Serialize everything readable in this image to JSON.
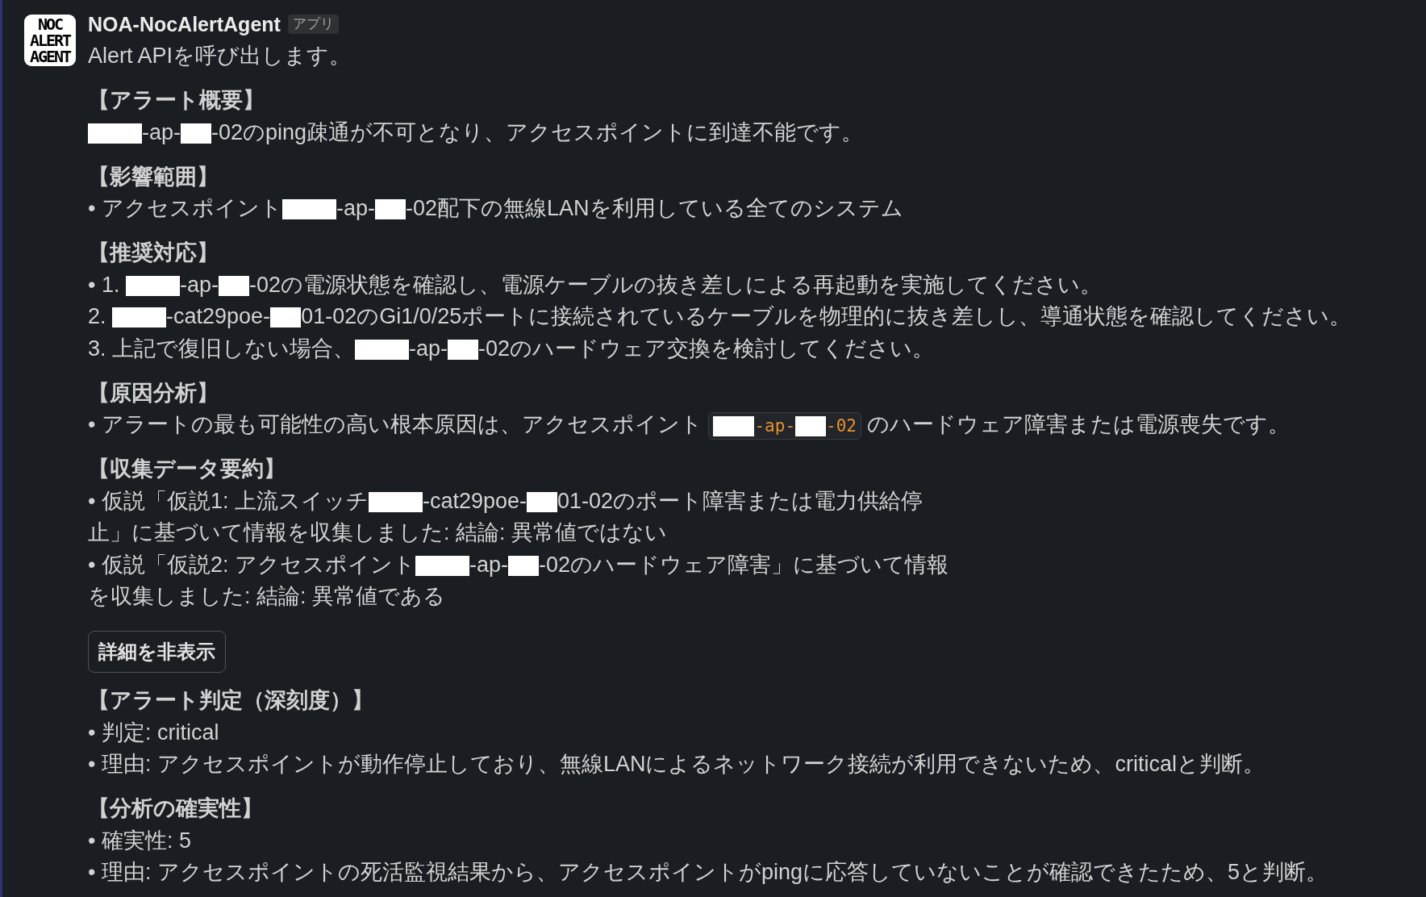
{
  "message": {
    "avatar": {
      "logo_lines": [
        "NOC",
        "ALERT",
        "AGENT"
      ]
    },
    "sender": "NOA-NocAlertAgent",
    "badge": "アプリ",
    "intro": "Alert APIを呼び出します。",
    "sections": [
      {
        "kind": "full",
        "heading": "【アラート概要】",
        "paragraphs": [
          [
            {
              "kind": "redaction_long"
            },
            {
              "kind": "text",
              "text": "-ap-"
            },
            {
              "kind": "redaction_short"
            },
            {
              "kind": "text",
              "text": "-02のping疎通が不可となり、アクセスポイントに到達不能です。"
            }
          ]
        ]
      },
      {
        "kind": "full",
        "heading": "【影響範囲】",
        "paragraphs": [
          [
            {
              "kind": "text",
              "text": "• アクセスポイント"
            },
            {
              "kind": "redaction_long"
            },
            {
              "kind": "text",
              "text": "-ap-"
            },
            {
              "kind": "redaction_short"
            },
            {
              "kind": "text",
              "text": "-02配下の無線LANを利用している全てのシステム"
            }
          ]
        ]
      },
      {
        "kind": "full",
        "heading": "【推奨対応】",
        "paragraphs": [
          [
            {
              "kind": "text",
              "text": "• 1. "
            },
            {
              "kind": "redaction_long"
            },
            {
              "kind": "text",
              "text": "-ap-"
            },
            {
              "kind": "redaction_short"
            },
            {
              "kind": "text",
              "text": "-02の電源状態を確認し、電源ケーブルの抜き差しによる再起動を実施してください。"
            }
          ],
          [
            {
              "kind": "text",
              "text": "2. "
            },
            {
              "kind": "redaction_long"
            },
            {
              "kind": "text",
              "text": "-cat29poe-"
            },
            {
              "kind": "redaction_short"
            },
            {
              "kind": "text",
              "text": "01-02のGi1/0/25ポートに接続されているケーブルを物理的に抜き差しし、導通状態を確認してください。"
            }
          ],
          [
            {
              "kind": "text",
              "text": "3. 上記で復旧しない場合、"
            },
            {
              "kind": "redaction_long"
            },
            {
              "kind": "text",
              "text": "-ap-"
            },
            {
              "kind": "redaction_short"
            },
            {
              "kind": "text",
              "text": "-02のハードウェア交換を検討してください。"
            }
          ]
        ]
      },
      {
        "kind": "full",
        "heading": "【原因分析】",
        "paragraphs": [
          [
            {
              "kind": "text",
              "text": "• アラートの最も可能性の高い根本原因は、アクセスポイント "
            },
            {
              "kind": "code",
              "parts": [
                {
                  "kind": "redaction_medium"
                },
                {
                  "kind": "text",
                  "text": "-ap-"
                },
                {
                  "kind": "redaction_short"
                },
                {
                  "kind": "text",
                  "text": "-02"
                }
              ]
            },
            {
              "kind": "text",
              "text": " のハードウェア障害または電源喪失です。"
            }
          ]
        ]
      },
      {
        "kind": "column",
        "heading": "【収集データ要約】",
        "paragraphs": [
          [
            {
              "kind": "text",
              "text": "• 仮説「仮説1: 上流スイッチ"
            },
            {
              "kind": "redaction_long"
            },
            {
              "kind": "text",
              "text": "-cat29poe-"
            },
            {
              "kind": "redaction_short"
            },
            {
              "kind": "text",
              "text": "01-02のポート障害または電力供給停止」に基づいて情報を収集しました: 結論: 異常値ではない"
            }
          ],
          [
            {
              "kind": "text",
              "text": "• 仮説「仮説2: アクセスポイント"
            },
            {
              "kind": "redaction_long"
            },
            {
              "kind": "text",
              "text": "-ap-"
            },
            {
              "kind": "redaction_short"
            },
            {
              "kind": "text",
              "text": "-02のハードウェア障害」に基づいて情報を収集しました: 結論: 異常値である"
            }
          ]
        ]
      }
    ],
    "toggle_button": "詳細を非表示",
    "details": [
      {
        "kind": "full",
        "heading": "【アラート判定（深刻度）】",
        "paragraphs": [
          [
            {
              "kind": "text",
              "text": "• 判定: critical"
            }
          ],
          [
            {
              "kind": "text",
              "text": "• 理由: アクセスポイントが動作停止しており、無線LANによるネットワーク接続が利用できないため、criticalと判断。"
            }
          ]
        ]
      },
      {
        "kind": "full",
        "heading": "【分析の確実性】",
        "paragraphs": [
          [
            {
              "kind": "text",
              "text": "• 確実性: 5"
            }
          ],
          [
            {
              "kind": "text",
              "text": "• 理由: アクセスポイントの死活監視結果から、アクセスポイントがpingに応答していないことが確認できたため、5と判断。"
            }
          ]
        ]
      }
    ]
  }
}
